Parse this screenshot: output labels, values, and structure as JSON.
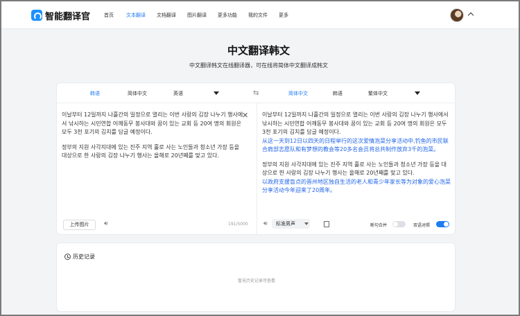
{
  "nav": {
    "brand": "智能翻译官",
    "items": [
      "首页",
      "文本翻译",
      "文档翻译",
      "图片翻译",
      "更多功能",
      "我的文件",
      "更多"
    ],
    "active_index": 1
  },
  "hero": {
    "title": "中文翻译韩文",
    "subtitle": "中文翻译韩文在线翻译器，可在线将简体中文翻译成韩文"
  },
  "translator": {
    "source_langs": [
      "韩语",
      "简体中文",
      "英语"
    ],
    "target_langs": [
      "简体中文",
      "韩语",
      "繁体中文"
    ],
    "source_paragraphs": [
      "이날부터 12일까지 나흘간의 일정으로 열리는 이번 사랑의 김장 나누기 행사에서 낚시하는 시민연합 어깨동무 봉사대와 꿈이 있는 교회 등 20여 명의 회원은 모두 3천 포기의 김치를 담글 예정이다.",
      "정부의 지원 사각지대에 있는 진주 지역 홀로 사는 노인들과 청소년 가장 등을 대상으로 한 사랑의 김장 나누기 행사는 올해로 20년째를 맞고 있다."
    ],
    "target_paragraphs": [
      {
        "original": "이날부터 12일까지 나흘간의 일정으로 열리는 이번 사랑의 김장 나누기 행사에서 낚시하는 시민연합 어깨동무 봉사대와 꿈이 있는 교회 등 20여 명의 회원은 모두 3천 포기의 김치를 담글 예정이다.",
        "translation": "从这一天到12日以四天的日程举行的这次爱情泡菜分享活动中,钓鱼的市民联合肩部志愿队和有梦想的教会等20多名会员将总共制作放弃3千的泡菜。"
      },
      {
        "original": "정부의 지원 사각지대에 있는 진주 지역 홀로 사는 노인들과 청소년 가장 등을 대상으로 한 사랑의 김장 나누기 행사는 올해로 20년째를 맞고 있다.",
        "translation": "以政府支援盲点的晋州地区独自生活的老人和青少年家长等为对象的爱心泡菜分享活动今年迎来了20周年。"
      }
    ],
    "upload_label": "上传图片",
    "char_count": "191/5000",
    "voice_label": "标准男声",
    "toggle_sentence_merge": {
      "label": "断句合并",
      "on": false
    },
    "toggle_bilingual": {
      "label": "双语对照",
      "on": true
    },
    "accent_color": "#1e7cf2",
    "translation_color": "#2166e8"
  },
  "history": {
    "title": "历史记录",
    "empty_text": "暂无历史记录可查看"
  }
}
